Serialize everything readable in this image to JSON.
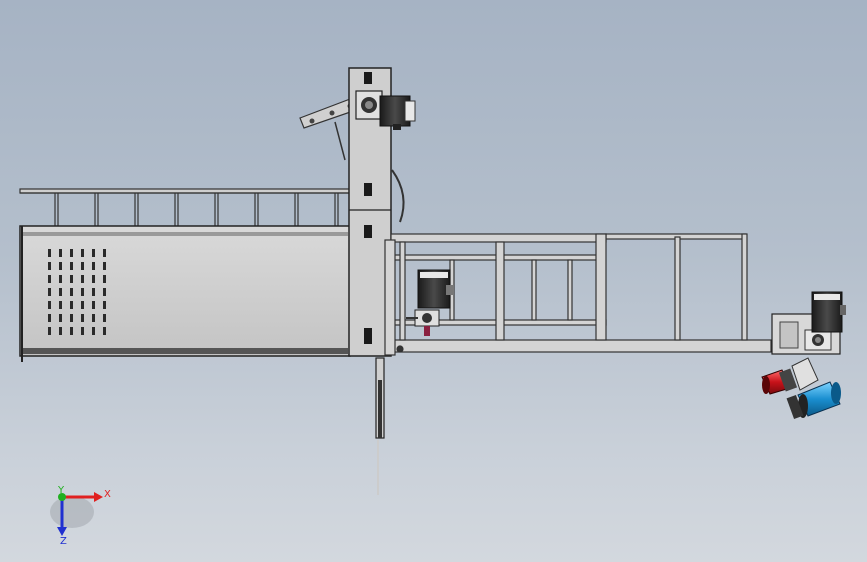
{
  "view": {
    "type": "3D CAD assembly view",
    "background_top": "#a6b3c4",
    "background_bottom": "#d3d8de"
  },
  "triad": {
    "x_label": "X",
    "y_label": "Y",
    "z_label": "Z",
    "x_color": "#e02020",
    "y_color": "#20b020",
    "z_color": "#2030d0"
  },
  "motors": {
    "body_color": "#2a2a2a",
    "accent_red": "#c8121a",
    "accent_blue": "#1aa0e0"
  }
}
